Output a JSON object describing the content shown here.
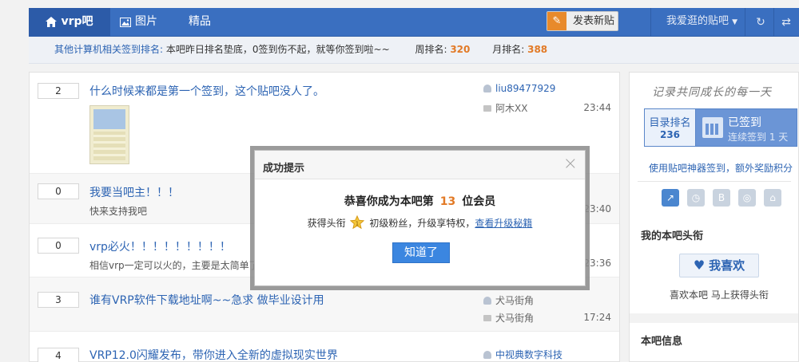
{
  "nav": {
    "forum_tab": "vrp吧",
    "pics_tab": "图片",
    "best_tab": "精品",
    "post_button": "发表新贴",
    "my_forums": "我爱逛的贴吧",
    "refresh_icon": "refresh-icon",
    "swap_icon": "swap-icon"
  },
  "rankbar": {
    "link": "其他计算机相关签到排名:",
    "text": "本吧昨日排名垫底，0签到伤不起，就等你签到啦~~",
    "week_label": "周排名:",
    "week_value": "320",
    "month_label": "月排名:",
    "month_value": "388"
  },
  "threads": [
    {
      "replies": "2",
      "title": "什么时候来都是第一个签到，这个贴吧没人了。",
      "snippet": "",
      "author": "liu89477929",
      "last_reply": "阿木XX",
      "time": "23:44"
    },
    {
      "replies": "0",
      "title": "我要当吧主！！！",
      "snippet": "快来支持我吧",
      "author": "",
      "last_reply": "",
      "time": "23:40"
    },
    {
      "replies": "0",
      "title": "vrp必火！！！！！！！！！",
      "snippet": "相信vrp一定可以火的，主要是太简单了",
      "author": "",
      "last_reply": "",
      "time": "23:36"
    },
    {
      "replies": "3",
      "title": "谁有VRP软件下载地址啊~~急求 做毕业设计用",
      "snippet": "",
      "author": "犬马街角",
      "last_reply": "犬马街角",
      "time": "17:24"
    },
    {
      "replies": "4",
      "title": "VRP12.0闪耀发布，带你进入全新的虚拟现实世界",
      "snippet": "",
      "author": "中视典数字科技",
      "last_reply": "",
      "time": ""
    }
  ],
  "sidebar": {
    "slogan": "记录共同成长的每一天",
    "rank_label": "目录排名",
    "rank_value": "236",
    "signed_label": "已签到",
    "streak": "连续签到 1 天",
    "tool_link": "使用贴吧神器签到，额外奖励积分",
    "my_title_heading": "我的本吧头衔",
    "like_button": "我喜欢",
    "like_text": "喜欢本吧  马上获得头衔",
    "info_heading": "本吧信息"
  },
  "dialog": {
    "title": "成功提示",
    "congrats_prefix": "恭喜你成为本吧第",
    "member_number": "13",
    "congrats_suffix": "位会员",
    "badge_prefix": "获得头衔",
    "badge_level": "1",
    "badge_suffix": "初级粉丝，升级享特权，",
    "upgrade_link": "查看升级秘籍",
    "ok_button": "知道了"
  },
  "colors": {
    "nav_blue": "#3a6fc0",
    "accent_orange": "#e27a26",
    "link_blue": "#2d64b3",
    "ok_button": "#3b86e0"
  }
}
